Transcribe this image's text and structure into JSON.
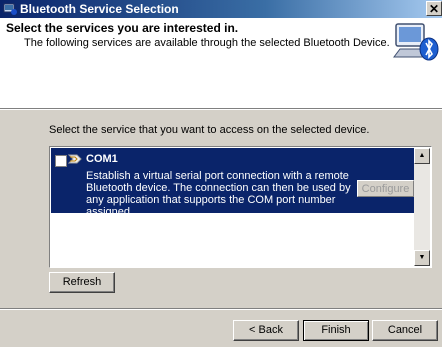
{
  "window": {
    "title": "Bluetooth Service Selection",
    "close_glyph": "✕"
  },
  "header": {
    "title": "Select the services you are interested in.",
    "subtitle": "The following services are available through the selected Bluetooth Device."
  },
  "main": {
    "prompt": "Select the service that you want to access on the selected device.",
    "services": [
      {
        "name": "COM1",
        "description": "Establish a virtual serial port connection with a remote Bluetooth device. The connection can then be used by any application that supports the COM port number assigned.",
        "checked": false,
        "selected": true,
        "configure_label": "Configure"
      }
    ],
    "refresh_label": "Refresh"
  },
  "footer": {
    "back_label": "< Back",
    "finish_label": "Finish",
    "cancel_label": "Cancel"
  },
  "colors": {
    "selection": "#0a246a",
    "dialog": "#d4d0c8",
    "title_gradient_start": "#0a246a",
    "title_gradient_end": "#a6caf0"
  },
  "icons": {
    "title": "bluetooth-window-icon",
    "header": "bluetooth-computer-icon",
    "service": "serial-port-icon"
  }
}
